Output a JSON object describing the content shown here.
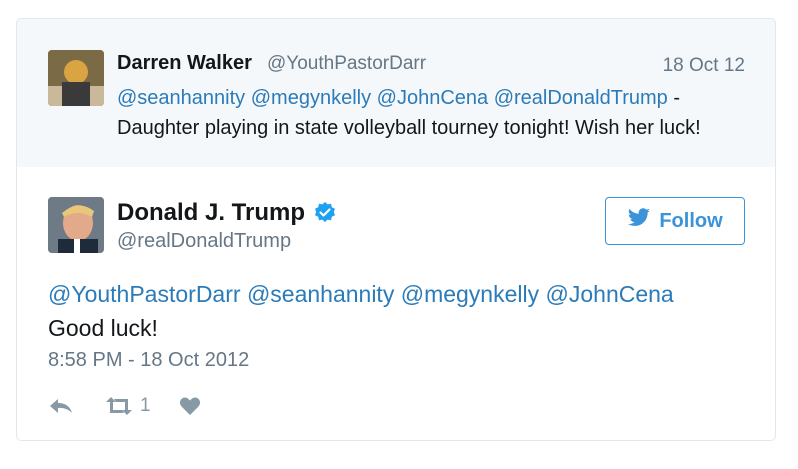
{
  "quoted_tweet": {
    "author_name": "Darren Walker",
    "author_handle": "@YouthPastorDarr",
    "date": "18 Oct 12",
    "mentions": [
      "@seanhannity",
      "@megynkelly",
      "@JohnCena",
      "@realDonaldTrump"
    ],
    "separator": " -",
    "text": "Daughter playing in state volleyball tourney tonight! Wish her luck!"
  },
  "tweet": {
    "author_name": "Donald J. Trump",
    "author_handle": "@realDonaldTrump",
    "follow_label": "Follow",
    "mentions": [
      "@YouthPastorDarr",
      "@seanhannity",
      "@megynkelly",
      "@JohnCena"
    ],
    "text": "Good luck!",
    "timestamp": "8:58 PM - 18 Oct 2012",
    "retweet_count": "1"
  },
  "colors": {
    "link": "#2b7bb9",
    "follow": "#3b94d9",
    "muted": "#657786",
    "quoted_bg": "#f5f8fa"
  },
  "icons": {
    "verified": "verified-badge-icon",
    "follow": "twitter-bird-icon",
    "reply": "reply-icon",
    "retweet": "retweet-icon",
    "like": "heart-icon"
  }
}
